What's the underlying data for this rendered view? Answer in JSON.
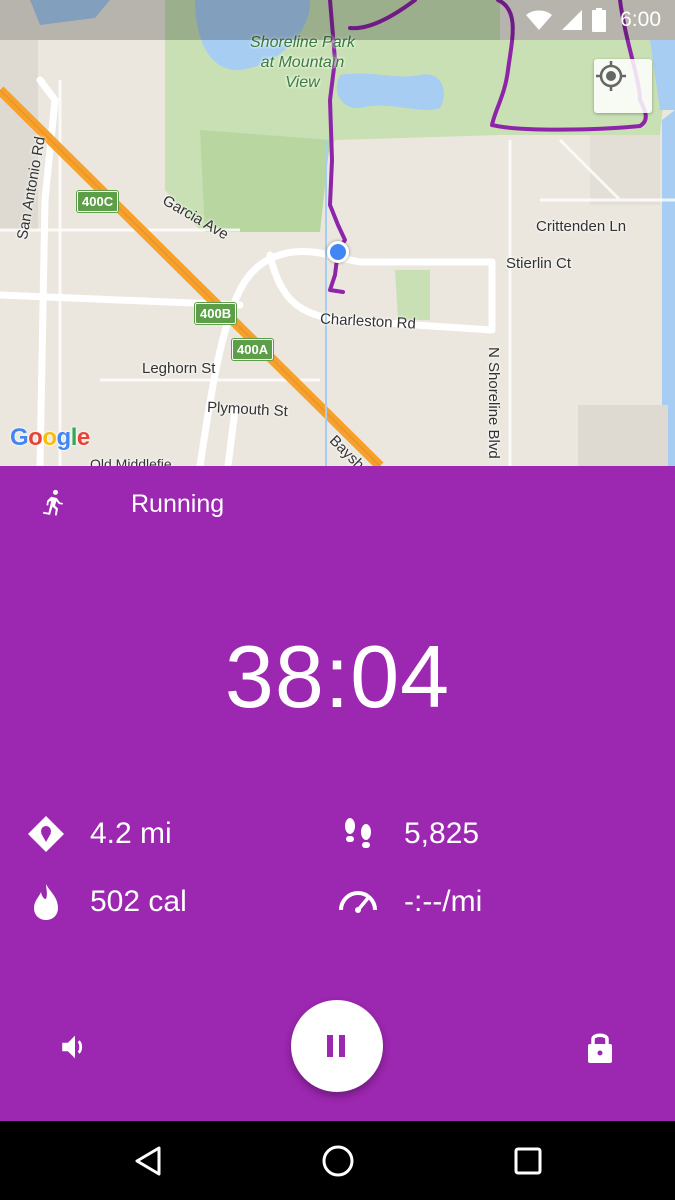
{
  "status_bar": {
    "time": "6:00",
    "icons": [
      "wifi-icon",
      "cell-signal-icon",
      "battery-icon"
    ]
  },
  "map": {
    "park_label": [
      "Shoreline Park",
      "at Mountain",
      "View"
    ],
    "street_labels": {
      "san_antonio": "San Antonio Rd",
      "garcia": "Garcia Ave",
      "charleston": "Charleston Rd",
      "leghorn": "Leghorn St",
      "plymouth": "Plymouth St",
      "crittenden": "Crittenden Ln",
      "stierlin": "Stierlin Ct",
      "shoreline_blvd": "N Shoreline Blvd",
      "bayshore": "Baysh",
      "old_middlefield": "Old Middlefie"
    },
    "exit_shields": [
      "400C",
      "400B",
      "400A"
    ],
    "logo": [
      "G",
      "o",
      "o",
      "g",
      "l",
      "e"
    ],
    "route_color": "#8e24aa",
    "freeway_color": "#f6a02d",
    "locate_icon": "my-location-icon"
  },
  "workout": {
    "activity_icon": "running-icon",
    "activity": "Running",
    "elapsed": "38:04",
    "distance": "4.2 mi",
    "steps": "5,825",
    "calories": "502 cal",
    "pace": "-:--/mi",
    "accent": "#9c27b0"
  },
  "controls": {
    "volume_icon": "volume-icon",
    "pause_icon": "pause-icon",
    "lock_icon": "lock-icon"
  },
  "nav": {
    "icons": [
      "back-icon",
      "home-icon",
      "recents-icon"
    ]
  }
}
